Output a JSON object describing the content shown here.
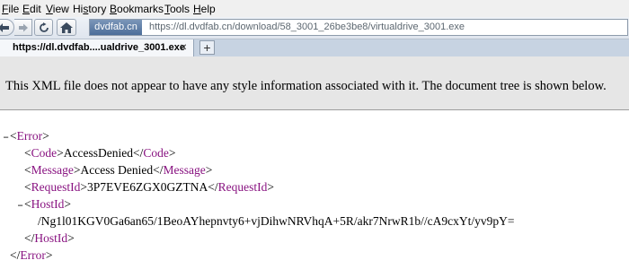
{
  "menu": {
    "items": [
      {
        "label": "File",
        "accel": "F",
        "rest": "ile"
      },
      {
        "label": "Edit",
        "accel": "E",
        "rest": "dit"
      },
      {
        "label": "View",
        "accel": "V",
        "rest": "iew"
      },
      {
        "label": "History",
        "accel": "s",
        "pre": "Hi",
        "rest": "tory"
      },
      {
        "label": "Bookmarks",
        "accel": "B",
        "rest": "ookmarks"
      },
      {
        "label": "Tools",
        "accel": "T",
        "rest": "ools"
      },
      {
        "label": "Help",
        "accel": "H",
        "rest": "elp"
      }
    ]
  },
  "nav": {
    "site_badge": "dvdfab.cn",
    "url": "https://dl.dvdfab.cn/download/58_3001_26be3be8/virtualdrive_3001.exe"
  },
  "tab": {
    "label": "https://dl.dvdfab....ualdrive_3001.exe",
    "close": "✕",
    "new_tab": "+"
  },
  "banner": {
    "text": "This XML file does not appear to have any style information associated with it. The document tree is shown below."
  },
  "xml": {
    "error_tag": "Error",
    "code_tag": "Code",
    "code_value": "AccessDenied",
    "message_tag": "Message",
    "message_value": "Access Denied",
    "requestid_tag": "RequestId",
    "requestid_value": "3P7EVE6ZGX0GZTNA",
    "hostid_tag": "HostId",
    "hostid_value": "/Ng1l01KGV0Ga6an65/1BeoAYhepnvty6+vjDihwNRVhqA+5R/akr7NrwR1b//cA9cxYt/yv9pY="
  },
  "colors": {
    "tag": "#881280",
    "banner_bg": "#e6e6e6"
  }
}
